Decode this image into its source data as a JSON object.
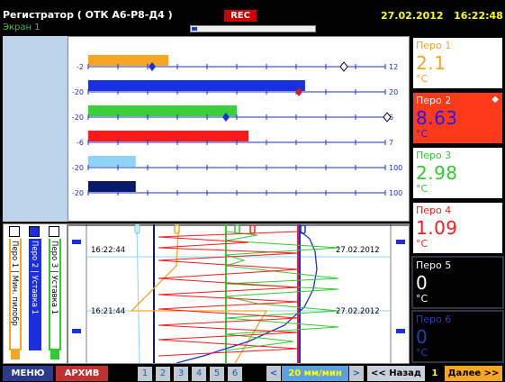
{
  "header": {
    "title": "Регистратор ( ОТК А6-Р8-Д4 )",
    "screen": "Экран 1",
    "rec_label": "REC",
    "date": "27.02.2012",
    "time": "16:22:48",
    "progress": 0.04
  },
  "bars": [
    {
      "min": "-2",
      "max": "12",
      "color": "#f5a623",
      "value_fraction": 0.27
    },
    {
      "min": "-20",
      "max": "20",
      "color": "#1a2fe0",
      "value_fraction": 0.73
    },
    {
      "min": "-20",
      "max": "6",
      "color": "#3ccf3c",
      "value_fraction": 0.5
    },
    {
      "min": "-6",
      "max": "7",
      "color": "#ff1a1a",
      "value_fraction": 0.54
    },
    {
      "min": "-20",
      "max": "100",
      "color": "#8fd3f5",
      "value_fraction": 0.16
    },
    {
      "min": "-20",
      "max": "100",
      "color": "#0a1a6b",
      "value_fraction": 0.16
    }
  ],
  "pens": [
    {
      "label": "Перо 1",
      "value": "2.1",
      "unit": "°C",
      "color": "#f5a623",
      "bg": "#ffffff",
      "label_color": "#f5a623"
    },
    {
      "label": "Перо 2",
      "value": "8.63",
      "unit": "°C",
      "color": "#1a1aff",
      "bg": "#ff3a1a",
      "label_color": "#ffffff"
    },
    {
      "label": "Перо 3",
      "value": "2.98",
      "unit": "°C",
      "color": "#2ecc2e",
      "bg": "#ffffff",
      "label_color": "#2ecc2e"
    },
    {
      "label": "Перо 4",
      "value": "1.09",
      "unit": "°C",
      "color": "#ff1a1a",
      "bg": "#ffffff",
      "label_color": "#ff1a1a"
    },
    {
      "label": "Перо 5",
      "value": "0",
      "unit": "°C",
      "color": "#ffffff",
      "bg": "#000000",
      "label_color": "#ffffff"
    },
    {
      "label": "Перо 6",
      "value": "0",
      "unit": "°C",
      "color": "#2040c0",
      "bg": "#000000",
      "label_color": "#2040c0"
    }
  ],
  "trend": {
    "time1": "16:22:44",
    "date1": "27.02.2012",
    "time2": "16:21:44",
    "date2": "27.02.2012"
  },
  "legend": {
    "pen1": "Перо 1 | Мин. пилобр",
    "pen2": "Перо 2 | Уставка 1",
    "pen3": "Перо 3 | Уставка 1"
  },
  "footer": {
    "menu": "МЕНЮ",
    "archive": "АРХИВ",
    "pages": [
      "1",
      "2",
      "3",
      "4",
      "5",
      "6"
    ],
    "speed": "20 мм/мин",
    "back": "<< Назад",
    "page_number": "1",
    "next": "Далее >>"
  }
}
